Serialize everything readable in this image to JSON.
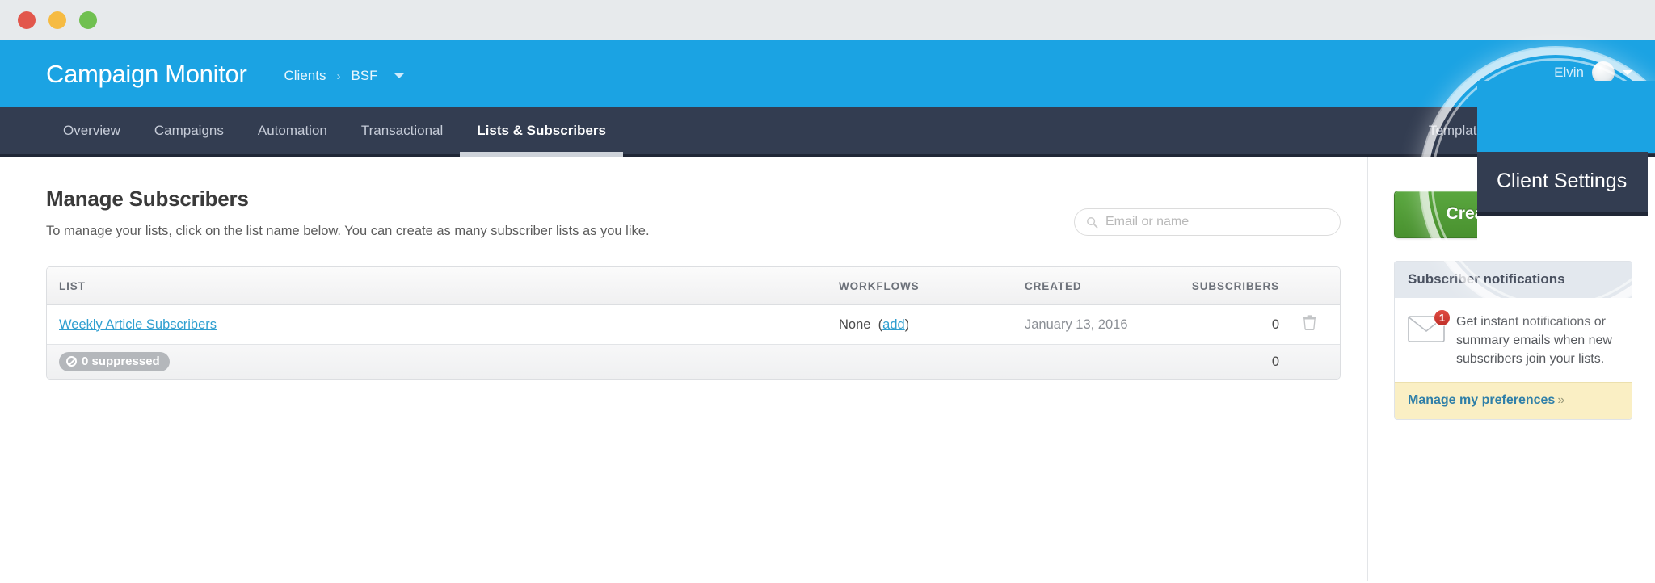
{
  "window": {
    "traffic_lights": [
      "close",
      "minimize",
      "maximize"
    ],
    "colors": {
      "close": "#e2574c",
      "minimize": "#f6bb42",
      "maximize": "#70c050"
    }
  },
  "header": {
    "logo": "Campaign Monitor",
    "brand_color": "#1ba3e3",
    "breadcrumb": {
      "root": "Clients",
      "separator": "›",
      "current": "BSF"
    },
    "user": {
      "name": "Elvin",
      "avatar": "avatar-image"
    }
  },
  "nav": {
    "bar_color": "#333d51",
    "left_items": [
      {
        "label": "Overview",
        "active": false
      },
      {
        "label": "Campaigns",
        "active": false
      },
      {
        "label": "Automation",
        "active": false
      },
      {
        "label": "Transactional",
        "active": false
      },
      {
        "label": "Lists & Subscribers",
        "active": true
      }
    ],
    "right_items": [
      {
        "label": "Templates",
        "active": false
      },
      {
        "label": "Client Settings",
        "active": false
      }
    ]
  },
  "highlight": {
    "target_label": "Client Settings",
    "shape": "circle-magnifier"
  },
  "main": {
    "title": "Manage Subscribers",
    "subtitle": "To manage your lists, click on the list name below. You can create as many subscriber lists as you like.",
    "search": {
      "placeholder": "Email or name",
      "value": "",
      "icon": "search-icon"
    },
    "table": {
      "columns": [
        "LIST",
        "WORKFLOWS",
        "CREATED",
        "SUBSCRIBERS"
      ],
      "rows": [
        {
          "list": "Weekly Article Subscribers",
          "workflows_none": "None",
          "workflows_add": "add",
          "created": "January 13, 2016",
          "subscribers": "0",
          "action": "delete-icon"
        }
      ],
      "suppressed_row": {
        "badge": "0 suppressed",
        "count": "0"
      }
    }
  },
  "sidebar": {
    "create_button": {
      "label": "Create a new list",
      "color": "#4f9a34"
    },
    "panel": {
      "heading": "Subscriber notifications",
      "badge_count": "1",
      "body": "Get instant notifications or summary emails when new subscribers join your lists.",
      "footer_link": "Manage my preferences",
      "footer_chevron": "»"
    }
  }
}
